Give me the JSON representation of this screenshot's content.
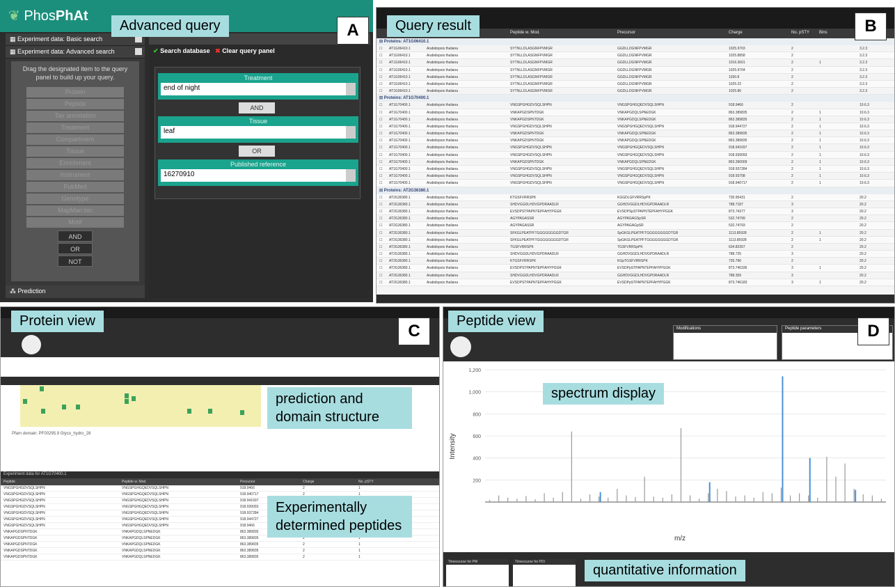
{
  "callouts": {
    "advanced_query": "Advanced query",
    "query_result": "Query result",
    "protein_view": "Protein view",
    "peptide_view": "Peptide view",
    "prediction_domain": "prediction and domain structure",
    "exp_peptides": "Experimentally determined peptides",
    "spectrum_display": "spectrum display",
    "quant_info": "quantitative information"
  },
  "letters": {
    "a": "A",
    "b": "B",
    "c": "C",
    "d": "D"
  },
  "panel_a": {
    "logo_prefix": "Phos",
    "logo_bold": "PhAt",
    "sidebar": {
      "basic": "Experiment data: Basic search",
      "advanced": "Experiment data: Advanced search",
      "drag_text": "Drag the designated item to the query panel to build up your query.",
      "fields": [
        "Protein",
        "Peptide",
        "Tair annotation",
        "Treatment",
        "Compartment",
        "Tissue",
        "Enrichment",
        "Instrument",
        "PubMed",
        "Genotype",
        "MapMan bin",
        "Motif"
      ],
      "ops": [
        "AND",
        "OR",
        "NOT"
      ],
      "prediction": "Prediction"
    },
    "toolbar": {
      "search": "Search database",
      "clear": "Clear query panel"
    },
    "query": {
      "rows": [
        {
          "label": "Treatment",
          "value": "end of night"
        },
        {
          "label": "Tissue",
          "value": "leaf"
        },
        {
          "label": "Published reference",
          "value": "16270910"
        }
      ],
      "ops": [
        "AND",
        "OR"
      ]
    }
  },
  "panel_b": {
    "columns": [
      "",
      "",
      "Peptide",
      "Peptide w. Mod.",
      "Precursor",
      "Charge",
      "No. pSTY",
      "Bins"
    ],
    "groups": [
      {
        "label": "Proteins: AT1G06410.1",
        "rows": [
          [
            "AT1G06410.1",
            "Arabidopsis thaliana",
            "SYTNLLDLASGNFPVMGR",
            "GGDLLDGNFPVMGR",
            "1025.9703",
            "2",
            "",
            "3.2.3"
          ],
          [
            "AT1G06410.1",
            "Arabidopsis thaliana",
            "SYTNLLDLASGNFPVMGR",
            "GGDLLDGNFPVMGR",
            "1025.8858",
            "2",
            "",
            "3.2.3"
          ],
          [
            "AT1G06410.1",
            "Arabidopsis thaliana",
            "SYTNLLDLASGNFPVMGR",
            "GGDLLDGNFPVMGR",
            "1016.3601",
            "2",
            "1",
            "3.2.3"
          ],
          [
            "AT1G06410.1",
            "Arabidopsis thaliana",
            "SYTNLLDLASGNFPVMGR",
            "GGDLLDGNFPVMGR",
            "1025.9704",
            "2",
            "",
            "3.2.3"
          ],
          [
            "AT1G06410.1",
            "Arabidopsis thaliana",
            "SYTNLLDLASGNFPVMGR",
            "GGDLLDGNFPVMGR",
            "1030.8",
            "2",
            "",
            "3.2.3"
          ],
          [
            "AT1G06410.1",
            "Arabidopsis thaliana",
            "SYTNLLDLASGNFPVMGR",
            "GGDLLDGNFPVMGR",
            "1025.22",
            "2",
            "",
            "3.2.3"
          ],
          [
            "AT1G06410.1",
            "Arabidopsis thaliana",
            "SYTNLLDLASGNFPVMGR",
            "GGDLLDGNFPVMGR",
            "1025.86",
            "2",
            "",
            "3.2.3"
          ]
        ]
      },
      {
        "label": "Proteins: AT1G70400.1",
        "rows": [
          [
            "AT1G70400.1",
            "Arabidopsis thaliana",
            "VNGSPGHGDVSQLSHPN",
            "VNGSPGHGQEDVSQLSHPN",
            "918.9466",
            "2",
            "",
            "10.6.3"
          ],
          [
            "AT1G70400.1",
            "Arabidopsis thaliana",
            "VNKAPGDSPNTDGK",
            "VNKAPGDQLSPNEDGK",
            "863.389835",
            "2",
            "1",
            "10.6.3"
          ],
          [
            "AT1G70400.1",
            "Arabidopsis thaliana",
            "VNKAPGDSPNTDGK",
            "VNKAPGDQLSPNEDGK",
            "863.389835",
            "2",
            "1",
            "10.6.3"
          ],
          [
            "AT1G70400.1",
            "Arabidopsis thaliana",
            "VNGSPGHGDVSQLSHPN",
            "VNGSPGHGQEDVSQLSHPN",
            "918.944727",
            "2",
            "1",
            "10.6.3"
          ],
          [
            "AT1G70400.1",
            "Arabidopsis thaliana",
            "VNKAPGDSPNTDGK",
            "VNKAPGDQLSPNEDGK",
            "863.389835",
            "2",
            "1",
            "10.6.3"
          ],
          [
            "AT1G70400.1",
            "Arabidopsis thaliana",
            "VNKAPGDSPNTDGK",
            "VNKAPGDQLSPNEDGK",
            "863.389835",
            "2",
            "1",
            "10.6.3"
          ],
          [
            "AT1G70400.1",
            "Arabidopsis thaliana",
            "VNGSPGHGDVSQLSHPN",
            "VNGSPGHGQEDVSQLSHPN",
            "918.941697",
            "2",
            "1",
            "10.6.3"
          ],
          [
            "AT1G70400.1",
            "Arabidopsis thaliana",
            "VNGSPGHGDVSQLSHPN",
            "VNGSPGHGQEDVSQLSHPN",
            "918.939093",
            "2",
            "1",
            "10.6.3"
          ],
          [
            "AT1G70400.1",
            "Arabidopsis thaliana",
            "VNKAPGDSPNTDGK",
            "VNKAPGDQLSPNEDGK",
            "863.390009",
            "2",
            "1",
            "10.6.3"
          ],
          [
            "AT1G70400.1",
            "Arabidopsis thaliana",
            "VNGSPGHGDVSQLSHPN",
            "VNGSPGHGQEDVSQLSHPN",
            "918.937284",
            "2",
            "1",
            "10.6.3"
          ],
          [
            "AT1G70400.1",
            "Arabidopsis thaliana",
            "VNGSPGHGDVSQLSHPN",
            "VNGSPGHGQEDVSQLSHPN",
            "918.93708",
            "2",
            "1",
            "10.6.3"
          ],
          [
            "AT1G70400.1",
            "Arabidopsis thaliana",
            "VNGSPGHGDVSQLSHPN",
            "VNGSPGHGQEDVSQLSHPN",
            "918.940717",
            "2",
            "1",
            "10.6.3"
          ]
        ]
      },
      {
        "label": "Proteins: AT2G36380.1",
        "rows": [
          [
            "AT2G36380.1",
            "Arabidopsis thaliana",
            "KTGSFVRRSPK",
            "KGGDLGFVRRSpPK",
            "735.95431",
            "2",
            "",
            "20.2"
          ],
          [
            "AT2G36380.1",
            "Arabidopsis thaliana",
            "SHDVGGDLHDVGPDRAADLR",
            "GGHDVGGDLHDVGPDRAADLR",
            "788.7187",
            "3",
            "",
            "20.2"
          ],
          [
            "AT2G36380.1",
            "Arabidopsis thaliana",
            "EVSDPSTPAPNTEPFAHYPGGK",
            "EVSDPSpSTPAPNTEPFAHYPGGK",
            "873.74377",
            "3",
            "",
            "20.2"
          ],
          [
            "AT2G36380.1",
            "Arabidopsis thaliana",
            "AGYPAGASSR",
            "AGYPAGAGSpSR",
            "532.74799",
            "2",
            "",
            "20.2"
          ],
          [
            "AT2G36380.1",
            "Arabidopsis thaliana",
            "AGYPAGASSR",
            "AGYPAGAGpSR",
            "532.74793",
            "2",
            "",
            "20.2"
          ],
          [
            "AT2G36380.1",
            "Arabidopsis thaliana",
            "SFKGLPEATPFTGGGGGGGGDTGR",
            "SpGKGLPEATPFTGGGGGGGGDTGR",
            "1113.85928",
            "2",
            "1",
            "20.2"
          ],
          [
            "AT2G36380.1",
            "Arabidopsis thaliana",
            "SFKGLPEATPFTGGGGGGGGDTGR",
            "SpGKGLPEATPFTGGGGGGGGDTGR",
            "1113.85928",
            "2",
            "1",
            "20.2"
          ],
          [
            "AT2G36380.1",
            "Arabidopsis thaliana",
            "TGSFVRRSPK",
            "TGSFVRRSpPK",
            "634.82357",
            "2",
            "",
            "20.2"
          ],
          [
            "AT2G36380.1",
            "Arabidopsis thaliana",
            "SHDVGGDLHDVGPDRAADLR",
            "GGHDVGGDLHDVGPDRAADLR",
            "788.725",
            "3",
            "",
            "20.2"
          ],
          [
            "AT2G36380.1",
            "Arabidopsis thaliana",
            "KTGSFVRRSPK",
            "KGpTGSFVRRSPK",
            "735.796",
            "2",
            "",
            "20.2"
          ],
          [
            "AT2G36380.1",
            "Arabidopsis thaliana",
            "EVSDPSTPAPNTEPFAHYPGGK",
            "EVSDPpSTPAPNTEPFAHYPGGK",
            "873.746336",
            "3",
            "1",
            "20.2"
          ],
          [
            "AT2G36380.1",
            "Arabidopsis thaliana",
            "SHDVGGDLHDVGPDRAADLR",
            "GGHDVGGDLHDVGPDRAADLR",
            "788.359",
            "3",
            "",
            "20.2"
          ],
          [
            "AT2G36380.1",
            "Arabidopsis thaliana",
            "EVSDPSTPAPNTEPFAHYPGGK",
            "EVSDPpSTPAPNTEPFAHYPGGK",
            "873.746183",
            "3",
            "1",
            "20.2"
          ]
        ]
      }
    ]
  },
  "panel_c": {
    "pfam_line1": "Pfam domain: PF00295.9 Glyco_hydro_28",
    "exp_header": "Experiment data for AT1G70400.1",
    "exp_columns": [
      "Peptide",
      "Peptide w. Mod.",
      "Precursor",
      "Charge",
      "No. pSTY"
    ],
    "exp_rows": [
      [
        "VNGSPGHGDVSQLSHPN",
        "VNGSPGHGQEDVSQLSHPN",
        "918.9466",
        "2",
        "1"
      ],
      [
        "VNGSPGHGDVSQLSHPN",
        "VNGSPGHGQEDVSQLSHPN",
        "918.940717",
        "2",
        "1"
      ],
      [
        "VNGSPGHGDVSQLSHPN",
        "VNGSPGHGQEDVSQLSHPN",
        "918.941697",
        "2",
        "1"
      ],
      [
        "VNGSPGHGDVSQLSHPN",
        "VNGSPGHGQEDVSQLSHPN",
        "918.939093",
        "2",
        "1"
      ],
      [
        "VNGSPGHGDVSQLSHPN",
        "VNGSPGHGQEDVSQLSHPN",
        "918.937284",
        "2",
        "1"
      ],
      [
        "VNGSPGHGDVSQLSHPN",
        "VNGSPGHGQEDVSQLSHPN",
        "918.944727",
        "2",
        "1"
      ],
      [
        "VNGSPGHGDVSQLSHPN",
        "VNGSPGHGQEDVSQLSHPN",
        "918.9466",
        "2",
        "1"
      ],
      [
        "VNKAPGDSPNTDGK",
        "VNKAPGDQLSPNEDGK",
        "863.389835",
        "2",
        "1"
      ],
      [
        "VNKAPGDSPNTDGK",
        "VNKAPGDQLSPNEDGK",
        "863.389835",
        "2",
        "1"
      ],
      [
        "VNKAPGDSPNTDGK",
        "VNKAPGDQLSPNEDGK",
        "863.389835",
        "2",
        "1"
      ],
      [
        "VNKAPGDSPNTDGK",
        "VNKAPGDQLSPNEDGK",
        "863.389835",
        "2",
        "1"
      ],
      [
        "VNKAPGDSPNTDGK",
        "VNKAPGDQLSPNEDGK",
        "863.389835",
        "2",
        "1"
      ]
    ]
  },
  "panel_d": {
    "mods_header": "Modifications",
    "params_header": "Peptide parameters",
    "quant1": "Timecourse for PM",
    "quant2": "Timecourse for PDI",
    "y_axis_label": "Intensity",
    "x_axis_label": "m/z",
    "y_ticks": [
      "200",
      "400",
      "600",
      "800",
      "1,000",
      "1,200"
    ]
  },
  "chart_data": {
    "type": "bar",
    "xlabel": "m/z",
    "ylabel": "Intensity",
    "ylim": [
      0,
      1200
    ],
    "series": [
      {
        "name": "",
        "color": "#999999",
        "values": [
          20,
          60,
          40,
          30,
          55,
          25,
          80,
          40,
          90,
          640,
          30,
          70,
          50,
          40,
          120,
          60,
          45,
          230,
          50,
          40,
          70,
          670,
          60,
          30,
          80,
          120,
          100,
          50,
          60,
          40,
          90,
          80,
          130,
          60,
          80,
          60,
          40,
          410,
          230,
          350,
          120,
          70,
          60,
          30
        ]
      },
      {
        "name": "",
        "color": "#4a8fd6",
        "values": [
          0,
          0,
          0,
          0,
          0,
          0,
          0,
          0,
          0,
          0,
          0,
          0,
          90,
          0,
          0,
          0,
          0,
          0,
          0,
          0,
          0,
          0,
          0,
          0,
          180,
          0,
          0,
          0,
          0,
          0,
          0,
          0,
          1140,
          0,
          0,
          400,
          0,
          0,
          0,
          0,
          110,
          0,
          0,
          0
        ]
      }
    ]
  }
}
